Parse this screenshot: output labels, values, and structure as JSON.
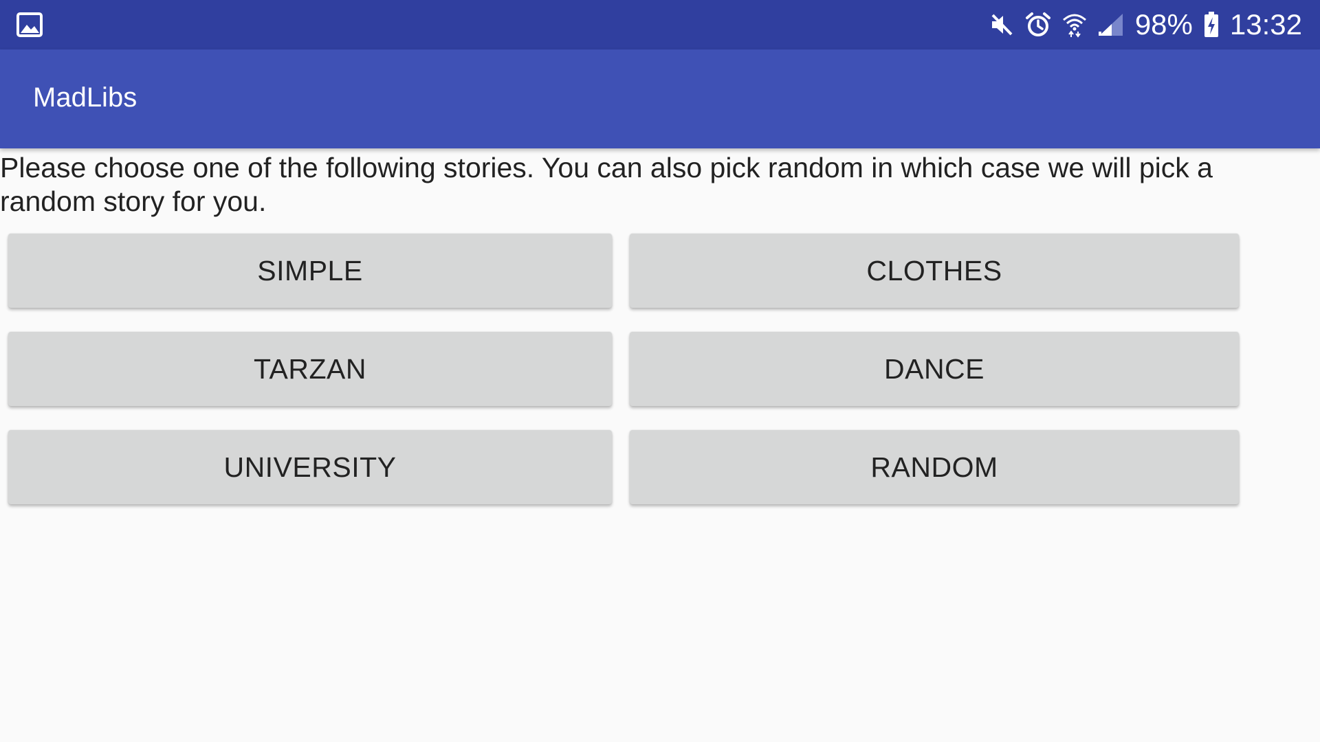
{
  "status_bar": {
    "left_icon": "image-notification-icon",
    "icons": [
      "mute-icon",
      "alarm-icon",
      "wifi-icon",
      "cell-signal-icon"
    ],
    "battery_percent": "98%",
    "battery_icon": "battery-charging-icon",
    "time": "13:32",
    "background_color": "#303f9f"
  },
  "app_bar": {
    "title": "MadLibs",
    "background_color": "#3f51b5"
  },
  "main": {
    "instructions": "Please choose one of the following stories. You can also pick random in which case we will pick a random story for you.",
    "buttons": [
      {
        "label": "SIMPLE"
      },
      {
        "label": "CLOTHES"
      },
      {
        "label": "TARZAN"
      },
      {
        "label": "DANCE"
      },
      {
        "label": "UNIVERSITY"
      },
      {
        "label": "RANDOM"
      }
    ],
    "button_color": "#d6d7d7",
    "background_color": "#fafafa"
  }
}
